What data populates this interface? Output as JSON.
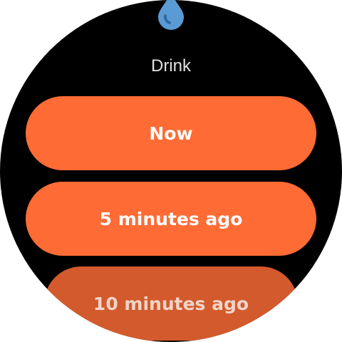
{
  "screen": {
    "title": "Drink",
    "icon": "water-drop-icon",
    "accent_color": "#ff6b35"
  },
  "options": [
    {
      "label": "Now"
    },
    {
      "label": "5 minutes ago"
    },
    {
      "label": "10 minutes ago"
    }
  ]
}
